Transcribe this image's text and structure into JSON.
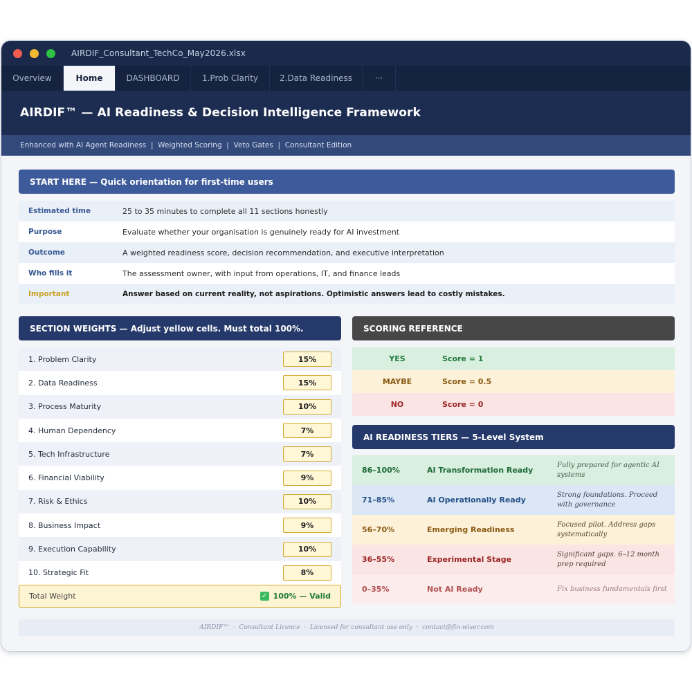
{
  "window": {
    "file_title": "AIRDIF_Consultant_TechCo_May2026.xlsx",
    "colors": {
      "titlebar": "#1b2a4b",
      "accent_yellow": "#d4a72c",
      "valid_green": "#1e7a3a"
    }
  },
  "tabs": [
    {
      "label": "Overview"
    },
    {
      "label": "Home"
    },
    {
      "label": "DASHBOARD"
    },
    {
      "label": "1.Prob Clarity"
    },
    {
      "label": "2.Data Readiness"
    },
    {
      "label": "···"
    }
  ],
  "active_tab": "Home",
  "hero": {
    "title": "AIRDIF™ — AI Readiness & Decision Intelligence Framework",
    "subtitle": "Enhanced with AI Agent Readiness  |  Weighted Scoring  |  Veto Gates  |  Consultant Edition"
  },
  "start_here": {
    "header": "START HERE — Quick orientation for first-time users",
    "rows": [
      {
        "key": "Estimated time",
        "value": "25 to 35 minutes to complete all 11 sections honestly"
      },
      {
        "key": "Purpose",
        "value": "Evaluate whether your organisation is genuinely ready for AI investment"
      },
      {
        "key": "Outcome",
        "value": "A weighted readiness score, decision recommendation, and executive interpretation"
      },
      {
        "key": "Who fills it",
        "value": "The assessment owner, with input from operations, IT, and finance leads"
      },
      {
        "key": "Important",
        "value": "Answer based on current reality, not aspirations. Optimistic answers lead to costly mistakes."
      }
    ]
  },
  "weights": {
    "header": "SECTION WEIGHTS — Adjust yellow cells. Must total 100%.",
    "rows": [
      {
        "label": "1. Problem Clarity",
        "value": "15%"
      },
      {
        "label": "2. Data Readiness",
        "value": "15%"
      },
      {
        "label": "3. Process Maturity",
        "value": "10%"
      },
      {
        "label": "4. Human Dependency",
        "value": "7%"
      },
      {
        "label": "5. Tech Infrastructure",
        "value": "7%"
      },
      {
        "label": "6. Financial Viability",
        "value": "9%"
      },
      {
        "label": "7. Risk & Ethics",
        "value": "10%"
      },
      {
        "label": "8. Business Impact",
        "value": "9%"
      },
      {
        "label": "9. Execution Capability",
        "value": "10%"
      },
      {
        "label": "10. Strategic Fit",
        "value": "8%"
      }
    ],
    "total_label": "Total Weight",
    "total_value": "100% — Valid",
    "check_glyph": "✓"
  },
  "scoring": {
    "header": "SCORING REFERENCE",
    "rows": [
      {
        "answer": "YES",
        "score": "Score = 1"
      },
      {
        "answer": "MAYBE",
        "score": "Score = 0.5"
      },
      {
        "answer": "NO",
        "score": "Score = 0"
      }
    ]
  },
  "tiers": {
    "header": "AI READINESS TIERS — 5-Level System",
    "rows": [
      {
        "range": "86–100%",
        "name": "AI Transformation Ready",
        "desc": "Fully prepared for agentic AI systems"
      },
      {
        "range": "71–85%",
        "name": "AI Operationally Ready",
        "desc": "Strong foundations. Proceed with governance"
      },
      {
        "range": "56–70%",
        "name": "Emerging Readiness",
        "desc": "Focused pilot. Address gaps systematically"
      },
      {
        "range": "36–55%",
        "name": "Experimental Stage",
        "desc": "Significant gaps. 6–12 month prep required"
      },
      {
        "range": "0–35%",
        "name": "Not AI Ready",
        "desc": "Fix business fundamentals first"
      }
    ]
  },
  "footer": {
    "text": "AIRDIF™  ·  Consultant Licence  ·  Licensed for consultant use only  ·  contact@fin-wiser.com"
  }
}
